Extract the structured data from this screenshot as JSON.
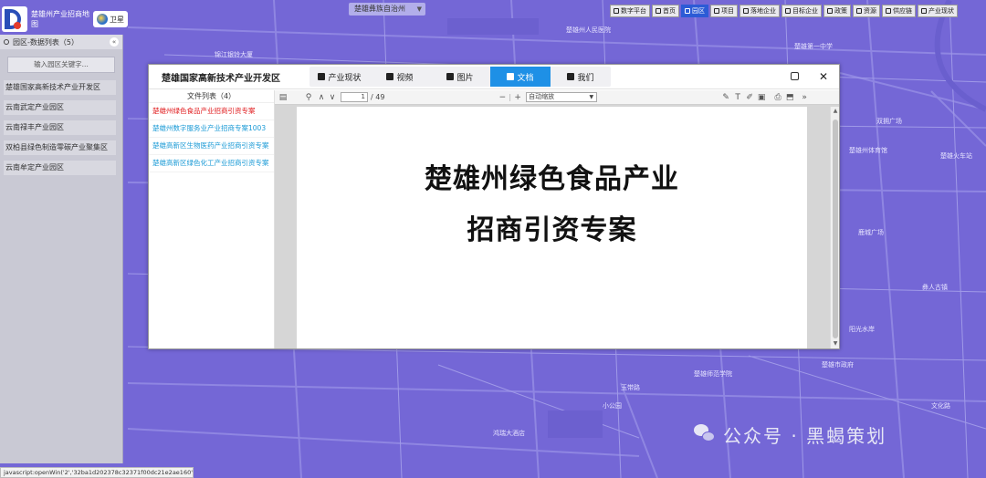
{
  "app": {
    "logo_title": "楚雄州产业招商地图",
    "satellite_label": "卫星"
  },
  "top_search": {
    "value": "楚雄彝族自治州"
  },
  "top_nav": [
    {
      "label": "数字平台",
      "active": false
    },
    {
      "label": "首页",
      "active": false
    },
    {
      "label": "园区",
      "active": true
    },
    {
      "label": "项目",
      "active": false
    },
    {
      "label": "落地企业",
      "active": false
    },
    {
      "label": "目标企业",
      "active": false
    },
    {
      "label": "政策",
      "active": false
    },
    {
      "label": "资源",
      "active": false
    },
    {
      "label": "供应链",
      "active": false
    },
    {
      "label": "产业现状",
      "active": false
    }
  ],
  "left_panel": {
    "header": "园区-数据列表（5）",
    "search_placeholder": "输入园区关键字...",
    "items": [
      "楚雄国家高新技术产业开发区",
      "云南武定产业园区",
      "云南禄丰产业园区",
      "双柏县绿色制造零碳产业聚集区",
      "云南牟定产业园区"
    ]
  },
  "dialog": {
    "title": "楚雄国家高新技术产业开发区",
    "tabs": [
      {
        "label": "产业现状",
        "icon": "info-icon",
        "active": false
      },
      {
        "label": "视频",
        "icon": "video-icon",
        "active": false
      },
      {
        "label": "图片",
        "icon": "image-icon",
        "active": false
      },
      {
        "label": "文档",
        "icon": "document-icon",
        "active": true
      },
      {
        "label": "我们",
        "icon": "phone-icon",
        "active": false
      }
    ],
    "file_list": {
      "header": "文件列表（4）",
      "items": [
        {
          "label": "楚雄州绿色食品产业招商引资专案",
          "active": true
        },
        {
          "label": "楚雄州数字服务业产业招商专案1003",
          "active": false
        },
        {
          "label": "楚雄高新区生物医药产业招商引资专案",
          "active": false
        },
        {
          "label": "楚雄高新区绿色化工产业招商引资专案",
          "active": false
        }
      ]
    },
    "viewer": {
      "page_current": "1",
      "page_total": "/ 49",
      "zoom": "自动缩放",
      "doc_title_line1": "楚雄州绿色食品产业",
      "doc_title_line2": "招商引资专案"
    }
  },
  "map_labels": [
    "锦江银铃大厦",
    "楚雄州人民医院",
    "楚雄第一中学",
    "双拥广场",
    "楚雄州体育馆",
    "楚雄火车站",
    "鹿城广场",
    "彝人古镇",
    "阳光水岸",
    "楚雄师范学院",
    "鸿瑞大酒店",
    "楚雄市政府",
    "玉带路",
    "小公园",
    "文化路"
  ],
  "watermark": "公众号 · 黑蝎策划",
  "status_bar": "javascript:openWin('2','32ba1d202378c32371f00dc21e2ae160', 4)"
}
